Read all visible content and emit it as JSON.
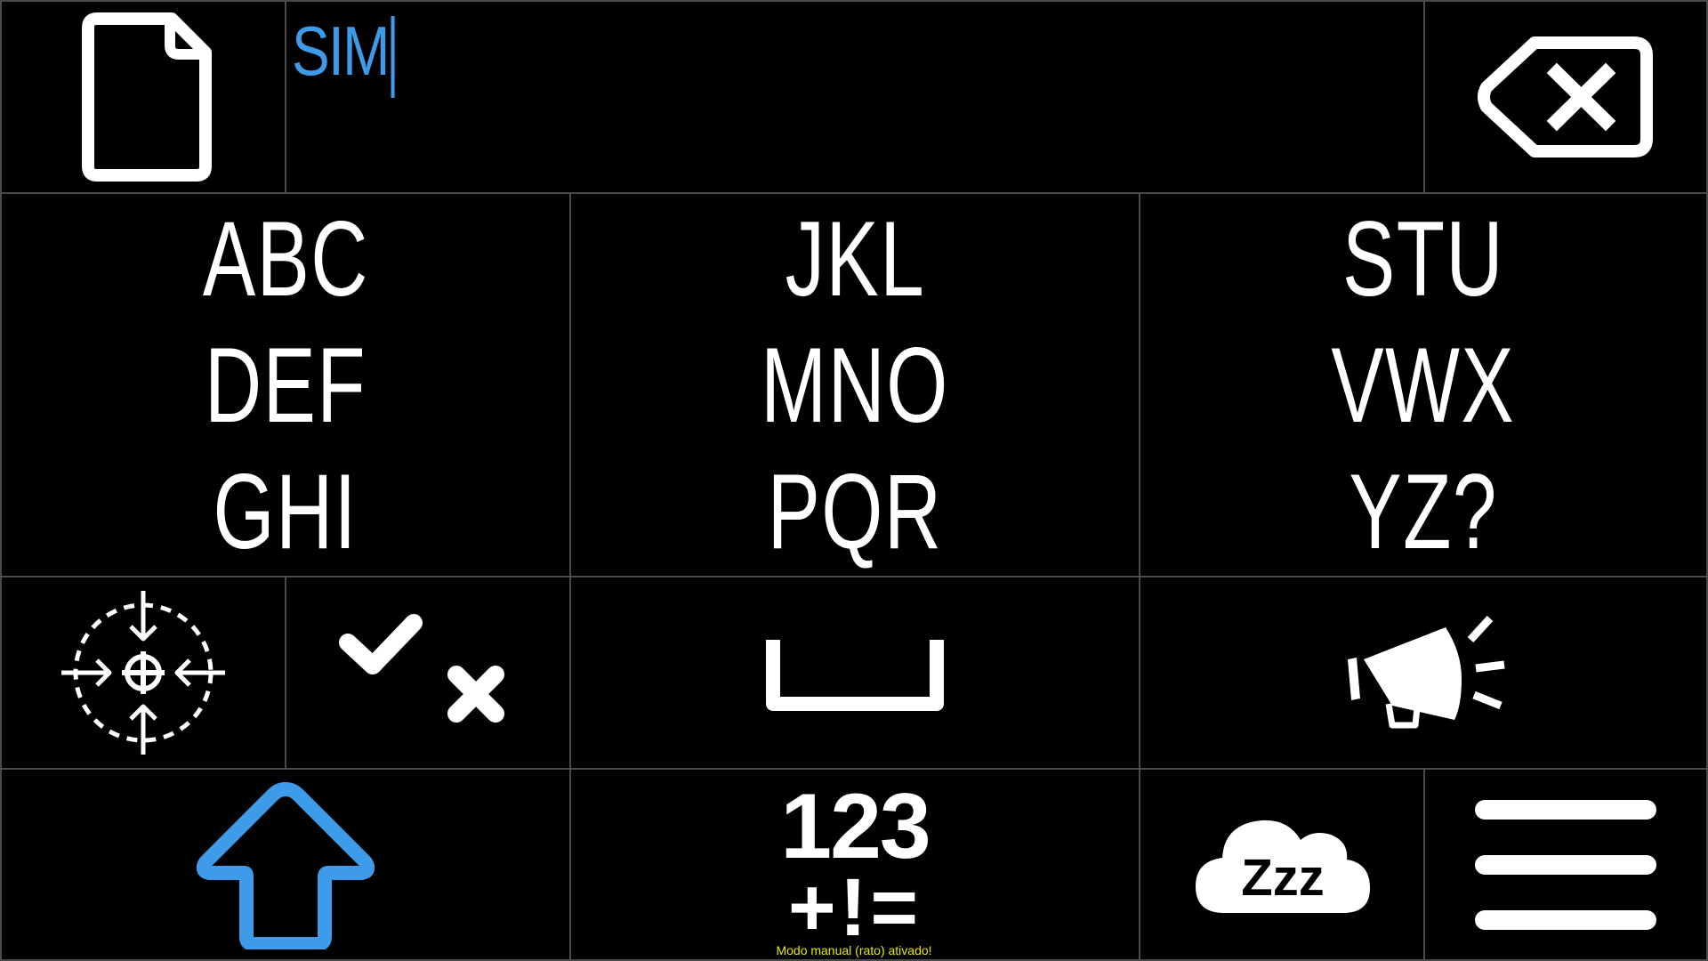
{
  "text_area": {
    "typed_text": "SIM"
  },
  "letter_groups": [
    {
      "lines": [
        "ABC",
        "DEF",
        "GHI"
      ]
    },
    {
      "lines": [
        "JKL",
        "MNO",
        "PQR"
      ]
    },
    {
      "lines": [
        "STU",
        "VWX",
        "YZ?"
      ]
    }
  ],
  "icons": {
    "new_document": "file-icon",
    "backspace": "backspace-icon",
    "calibrate": "crosshair-calibrate-icon",
    "yes_no": "check-cross-icon",
    "space": "space-bar-icon",
    "speak": "megaphone-icon",
    "shift": "shift-arrow-icon",
    "numbers_symbols": "numbers-symbols-icon",
    "sleep": "sleep-cloud-icon",
    "menu": "hamburger-menu-icon"
  },
  "numbers_key": {
    "top": "123",
    "bottom": "+!="
  },
  "sleep_key": {
    "label": "Zzz"
  },
  "status_message": "Modo manual (rato) ativado!",
  "colors": {
    "accent": "#3d9be9",
    "status": "#e8e800",
    "border": "#4a4a4a"
  }
}
